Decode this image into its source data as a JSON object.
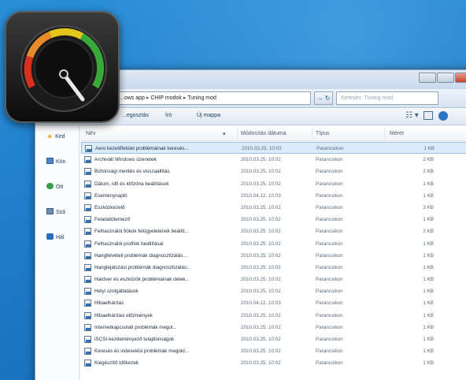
{
  "address": {
    "segments": [
      "...ows app",
      "CHIP modok",
      "Tuning mod"
    ],
    "separator": "▸"
  },
  "refresh_glyph": "→ ↻",
  "search": {
    "placeholder": "Keresés: Tuning mod"
  },
  "toolbar": {
    "organize": "...egosztás",
    "new_folder": "Író",
    "tool3": "Új mappa",
    "views_glyph": "☷ ▾"
  },
  "nav": {
    "items": [
      {
        "label": "Ked",
        "icon": "star-icon"
      },
      {
        "label": "Kön",
        "icon": "library-icon"
      },
      {
        "label": "Ott",
        "icon": "homegroup-icon"
      },
      {
        "label": "Szá",
        "icon": "computer-icon"
      },
      {
        "label": "Hál",
        "icon": "network-icon"
      }
    ]
  },
  "columns": {
    "name": "Név",
    "date": "Módosítás dátuma",
    "type": "Típus",
    "size": "Méret"
  },
  "files": [
    {
      "name": "Aero kezelőfelület problémáinak keresés...",
      "date": "2010.03.25. 10:02",
      "type": "Parancsikon",
      "size": "1 KB"
    },
    {
      "name": "Archivált Windows üzenetek",
      "date": "2010.03.25. 10:02",
      "type": "Parancsikon",
      "size": "2 KB"
    },
    {
      "name": "Biztonsági mentés és visszaállítás",
      "date": "2010.03.25. 10:02",
      "type": "Parancsikon",
      "size": "2 KB"
    },
    {
      "name": "Dátum, idő és időzóna beállítások",
      "date": "2010.03.25. 10:02",
      "type": "Parancsikon",
      "size": "1 KB"
    },
    {
      "name": "Eseménynapló",
      "date": "2010.04.12. 10:03",
      "type": "Parancsikon",
      "size": "1 KB"
    },
    {
      "name": "Eszközkezelő",
      "date": "2010.03.25. 10:02",
      "type": "Parancsikon",
      "size": "3 KB"
    },
    {
      "name": "Feladatütemező",
      "date": "2010.03.25. 10:02",
      "type": "Parancsikon",
      "size": "1 KB"
    },
    {
      "name": "Felhasználói fiókok felügyeletének beállít...",
      "date": "2010.03.25. 10:02",
      "type": "Parancsikon",
      "size": "2 KB"
    },
    {
      "name": "Felhasználói profilok beállításai",
      "date": "2010.03.25. 10:02",
      "type": "Parancsikon",
      "size": "1 KB"
    },
    {
      "name": "Hangfelvételi problémák diagnosztizálás...",
      "date": "2010.03.25. 10:02",
      "type": "Parancsikon",
      "size": "1 KB"
    },
    {
      "name": "Hanglejátszási problémák diagnosztizálás...",
      "date": "2010.03.25. 10:02",
      "type": "Parancsikon",
      "size": "1 KB"
    },
    {
      "name": "Hardver és eszközök problémáinak detek...",
      "date": "2010.03.25. 10:02",
      "type": "Parancsikon",
      "size": "1 KB"
    },
    {
      "name": "Helyi szolgáltatások",
      "date": "2010.03.25. 10:02",
      "type": "Parancsikon",
      "size": "1 KB"
    },
    {
      "name": "Hibaelhárítás",
      "date": "2010.04.12. 10:03",
      "type": "Parancsikon",
      "size": "1 KB"
    },
    {
      "name": "Hibaelhárítási előzmények",
      "date": "2010.03.25. 10:02",
      "type": "Parancsikon",
      "size": "1 KB"
    },
    {
      "name": "Internetkapcsolati problémák megol...",
      "date": "2010.03.25. 10:02",
      "type": "Parancsikon",
      "size": "1 KB"
    },
    {
      "name": "iSCSI-kezdeményező tulajdonságok",
      "date": "2010.03.25. 10:02",
      "type": "Parancsikon",
      "size": "1 KB"
    },
    {
      "name": "Keresés és indexelési problémák megold...",
      "date": "2010.03.25. 10:02",
      "type": "Parancsikon",
      "size": "1 KB"
    },
    {
      "name": "Kiegészítő időkezek",
      "date": "2010.03.25. 10:02",
      "type": "Parancsikon",
      "size": "1 KB"
    }
  ],
  "colors": {
    "desktop": "#1f7bc8",
    "selection": "#dcebfc",
    "gauge_green": "#3aa83a",
    "gauge_yellow": "#e2c61c",
    "gauge_red": "#d8321e"
  }
}
